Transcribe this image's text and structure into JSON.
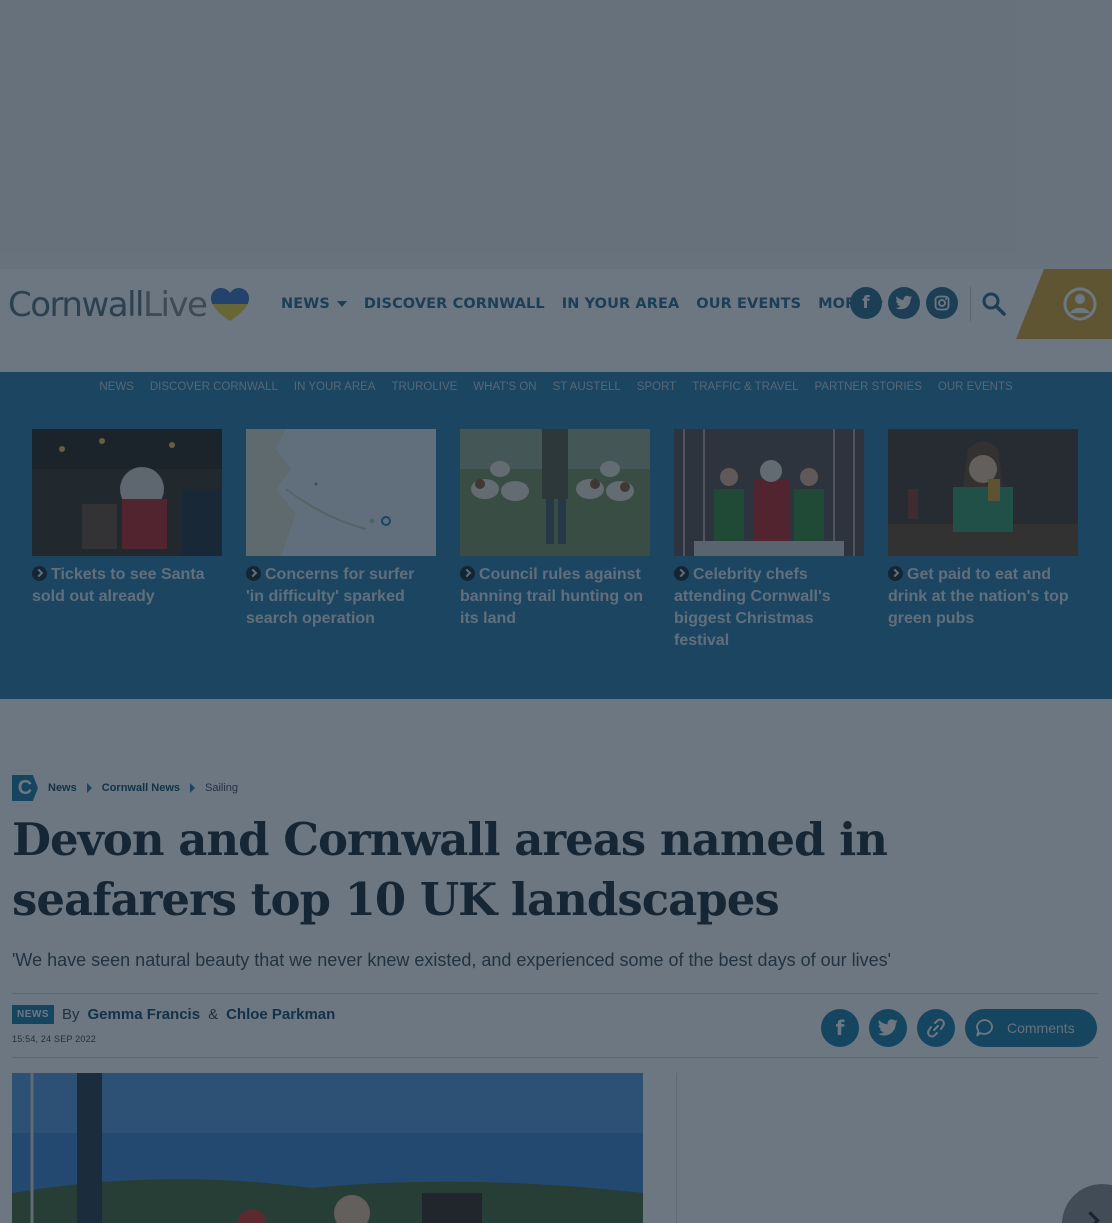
{
  "header": {
    "logo_text_a": "Cornwall",
    "logo_text_b": "Live",
    "nav": [
      {
        "label": "NEWS",
        "has_caret": true
      },
      {
        "label": "DISCOVER CORNWALL",
        "has_caret": false
      },
      {
        "label": "IN YOUR AREA",
        "has_caret": false
      },
      {
        "label": "OUR EVENTS",
        "has_caret": false
      },
      {
        "label": "MORE",
        "has_caret": true
      }
    ],
    "social_icons": [
      "facebook-icon",
      "twitter-icon",
      "instagram-icon"
    ],
    "search_icon": "search-icon",
    "account_icon": "account-icon",
    "accent_color": "#e0a530"
  },
  "subnav": {
    "links": [
      "NEWS",
      "DISCOVER CORNWALL",
      "IN YOUR AREA",
      "TRUROLIVE",
      "WHAT'S ON",
      "ST AUSTELL",
      "SPORT",
      "TRAFFIC & TRAVEL",
      "PARTNER STORIES",
      "OUR EVENTS"
    ],
    "cards": [
      {
        "title": "Tickets to see Santa sold out already"
      },
      {
        "title": "Concerns for surfer 'in difficulty' sparked search operation"
      },
      {
        "title": "Council rules against banning trail hunting on its land"
      },
      {
        "title": "Celebrity chefs attending Cornwall's biggest Christmas festival"
      },
      {
        "title": "Get paid to eat and drink at the nation's top green pubs"
      }
    ]
  },
  "breadcrumb": {
    "logo_letter": "C",
    "items": [
      "News",
      "Cornwall News",
      "Sailing"
    ]
  },
  "article": {
    "headline": "Devon and Cornwall areas named in seafarers top 10 UK landscapes",
    "standfirst": "'We have seen natural beauty that we never knew existed, and experienced some of the best days of our lives'",
    "badge": "NEWS",
    "by": "By",
    "author_1": "Gemma Francis",
    "amp": "&",
    "author_2": "Chloe Parkman",
    "timestamp": "15:54, 24 SEP 2022",
    "comments_label": "Comments"
  },
  "colors": {
    "brand_blue": "#1f7ba6",
    "nav_blue": "#2d6c8c",
    "subnav_bg": "#2a7cac"
  }
}
